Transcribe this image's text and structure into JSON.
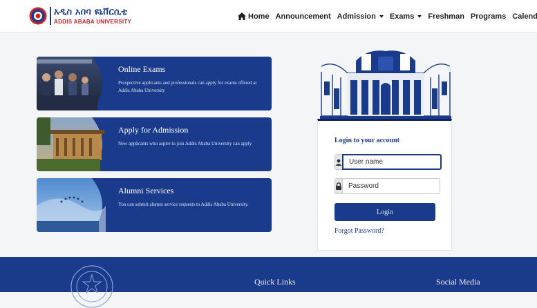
{
  "brand": {
    "amharic": "አዲስ አበባ ዩኒቨርሲቲ",
    "english": "ADDIS ABABA UNIVERSITY"
  },
  "nav": {
    "home": "Home",
    "announcement": "Announcement",
    "admission": "Admission",
    "exams": "Exams",
    "freshman": "Freshman",
    "programs": "Programs",
    "calendar": "Calendar"
  },
  "cards": [
    {
      "title": "Online Exams",
      "desc": "Prospective applicants and professionals can apply for exams offered at Addis Ababa University"
    },
    {
      "title": "Apply for Admission",
      "desc": "New applicants who aspire to join Addis Ababa University can apply"
    },
    {
      "title": "Alumni Services",
      "desc": "You can submit alumni service requests to Addis Ababa University."
    }
  ],
  "login": {
    "title": "Login to your account",
    "username_placeholder": "User name",
    "password_placeholder": "Password",
    "button": "Login",
    "forgot": "Forgot Password?"
  },
  "footer": {
    "quick_links": "Quick Links",
    "social_media": "Social Media"
  },
  "colors": {
    "primary": "#1a3a8c",
    "brand_red": "#c8242b",
    "footer_bg": "#1a3a8c"
  }
}
